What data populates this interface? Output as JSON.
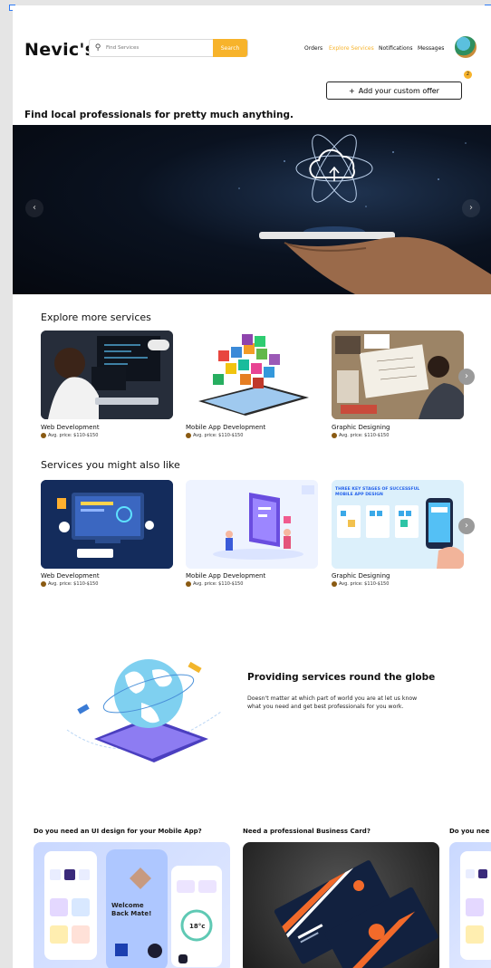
{
  "app": {
    "logo": "Nevic's"
  },
  "header": {
    "search_placeholder": "Find Services",
    "search_button": "Search",
    "nav": [
      "Orders",
      "Explore Services",
      "Notifications",
      "Messages"
    ],
    "notification_count": "2",
    "add_offer_label": "Add your custom offer",
    "add_offer_icon": "+"
  },
  "headline": "Find local professionals for pretty much anything.",
  "explore": {
    "title": "Explore more services",
    "items": [
      {
        "title": "Web Development",
        "price": "Avg. price: $110-$150"
      },
      {
        "title": "Mobile App Development",
        "price": "Avg. price: $110-$150"
      },
      {
        "title": "Graphic Designing",
        "price": "Avg. price: $110-$150"
      }
    ]
  },
  "also_like": {
    "title": "Services you might also like",
    "items": [
      {
        "title": "Web Development",
        "price": "Avg. price: $110-$150"
      },
      {
        "title": "Mobile App Development",
        "price": "Avg. price: $110-$150"
      },
      {
        "title": "Graphic Designing",
        "price": "Avg. price: $110-$150"
      }
    ],
    "graphic_banner": "THREE KEY STAGES OF SUCCESSFUL MOBILE APP DESIGN"
  },
  "globe": {
    "title": "Providing services round the globe",
    "text": "Doesn't matter at which part of world you are at let us know what you need and get best professionals for you work."
  },
  "promos": [
    {
      "title": "Do you need an UI design for your Mobile App?"
    },
    {
      "title": "Need a professional Business Card?"
    },
    {
      "title": "Do you nee"
    }
  ],
  "mock_text": {
    "welcome": "Welcome Back Mate!",
    "temp": "18°c"
  },
  "colors": {
    "accent": "#f7b32b",
    "selection": "#2f7bf5"
  }
}
